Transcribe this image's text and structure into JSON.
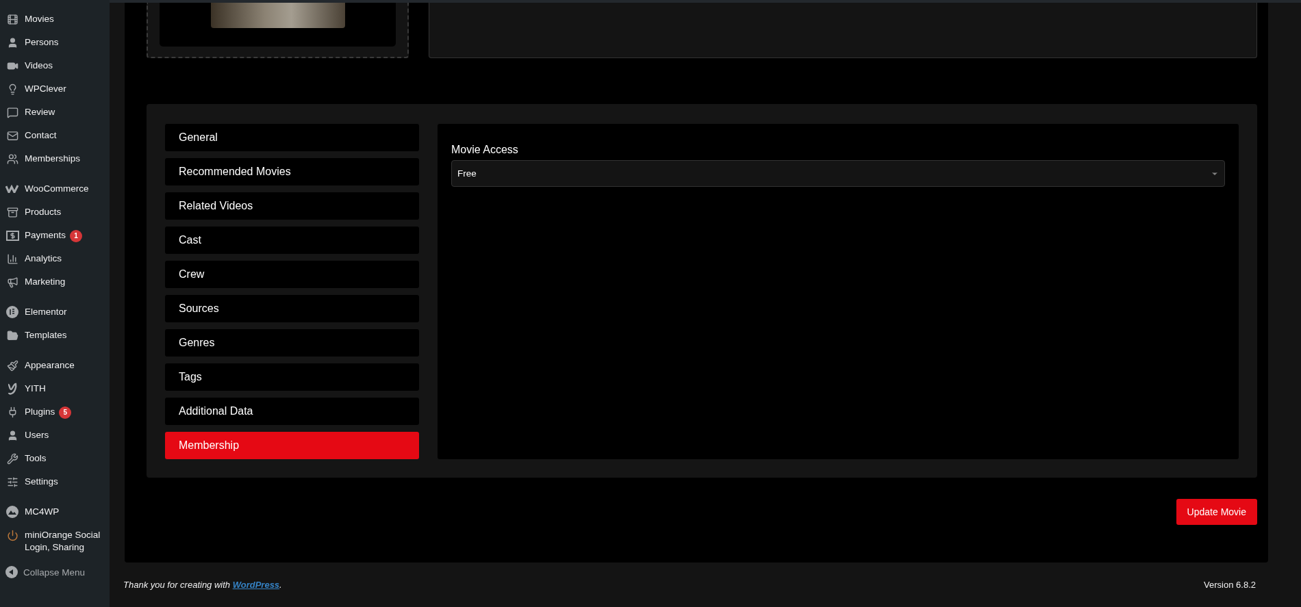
{
  "sidebar": {
    "groups": [
      [
        {
          "label": "Movies"
        },
        {
          "label": "Persons"
        },
        {
          "label": "Videos"
        },
        {
          "label": "WPClever"
        },
        {
          "label": "Review"
        },
        {
          "label": "Contact"
        },
        {
          "label": "Memberships"
        }
      ],
      [
        {
          "label": "WooCommerce"
        },
        {
          "label": "Products"
        },
        {
          "label": "Payments",
          "badge": "1"
        },
        {
          "label": "Analytics"
        },
        {
          "label": "Marketing"
        }
      ],
      [
        {
          "label": "Elementor"
        },
        {
          "label": "Templates"
        }
      ],
      [
        {
          "label": "Appearance"
        },
        {
          "label": "YITH"
        },
        {
          "label": "Plugins",
          "badge": "5"
        },
        {
          "label": "Users"
        },
        {
          "label": "Tools"
        },
        {
          "label": "Settings"
        }
      ],
      [
        {
          "label": "MC4WP"
        },
        {
          "label": "miniOrange Social Login, Sharing"
        }
      ]
    ],
    "collapse_label": "Collapse Menu"
  },
  "tabs": [
    {
      "label": "General",
      "selected": false
    },
    {
      "label": "Recommended Movies",
      "selected": false
    },
    {
      "label": "Related Videos",
      "selected": false
    },
    {
      "label": "Cast",
      "selected": false
    },
    {
      "label": "Crew",
      "selected": false
    },
    {
      "label": "Sources",
      "selected": false
    },
    {
      "label": "Genres",
      "selected": false
    },
    {
      "label": "Tags",
      "selected": false
    },
    {
      "label": "Additional Data",
      "selected": false
    },
    {
      "label": "Membership",
      "selected": true
    }
  ],
  "panel": {
    "field_label": "Movie Access",
    "select_value": "Free"
  },
  "update_button": "Update Movie",
  "footer": {
    "thanks": "Thank you for creating with ",
    "link": "WordPress",
    "after_link": ".",
    "version": "Version 6.8.2"
  }
}
